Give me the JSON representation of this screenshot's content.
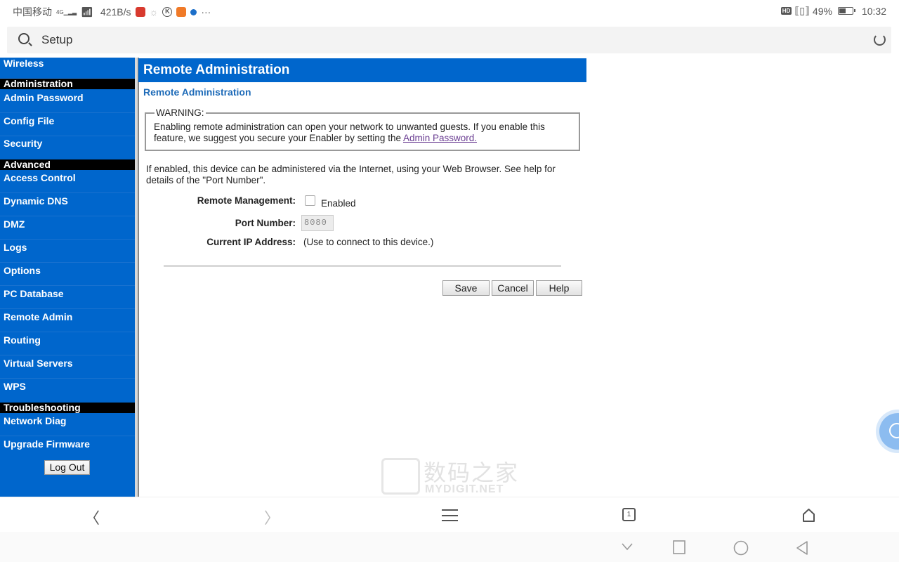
{
  "status_bar": {
    "carrier": "中国移动",
    "network": "4G",
    "speed": "421B/s",
    "battery": "49%",
    "time": "10:32",
    "hd_badge": "HD",
    "more": "···",
    "k_badge": "K"
  },
  "address_bar": {
    "text": "Setup"
  },
  "sidebar": {
    "top_item": "Wireless",
    "sections": [
      {
        "title": "Administration",
        "items": [
          "Admin Password",
          "Config File",
          "Security"
        ]
      },
      {
        "title": "Advanced",
        "items": [
          "Access Control",
          "Dynamic DNS",
          "DMZ",
          "Logs",
          "Options",
          "PC Database",
          "Remote Admin",
          "Routing",
          "Virtual Servers",
          "WPS"
        ]
      },
      {
        "title": "Troubleshooting",
        "items": [
          "Network Diag",
          "Upgrade Firmware"
        ]
      }
    ],
    "logout_label": "Log Out"
  },
  "content": {
    "header_title": "Remote Administration",
    "subtitle": "Remote Administration",
    "warning": {
      "legend": "WARNING:",
      "text": "Enabling remote administration can open your network to unwanted guests. If you enable this feature, we suggest you secure your Enabler by setting the ",
      "link_text": "Admin Password."
    },
    "intro": "If enabled, this device can be administered via the Internet, using your Web Browser. See help for details of the \"Port Number\".",
    "form": {
      "remote_management_label": "Remote Management:",
      "remote_management_checked": false,
      "enabled_label": "Enabled",
      "port_number_label": "Port Number:",
      "port_number_value": "8080",
      "current_ip_label": "Current IP Address:",
      "current_ip_note": "(Use to connect to this device.)"
    },
    "buttons": {
      "save": "Save",
      "cancel": "Cancel",
      "help": "Help"
    }
  },
  "watermark": {
    "cn": "数码之家",
    "en": "MYDIGIT.NET"
  },
  "browser_toolbar": {
    "back": "〈",
    "forward": "〉",
    "tab_count": "1"
  },
  "colors": {
    "brand_blue": "#0066cc",
    "section_black": "#000000",
    "subtitle_blue": "#1e6bb8",
    "link_purple": "#6a3d92"
  }
}
